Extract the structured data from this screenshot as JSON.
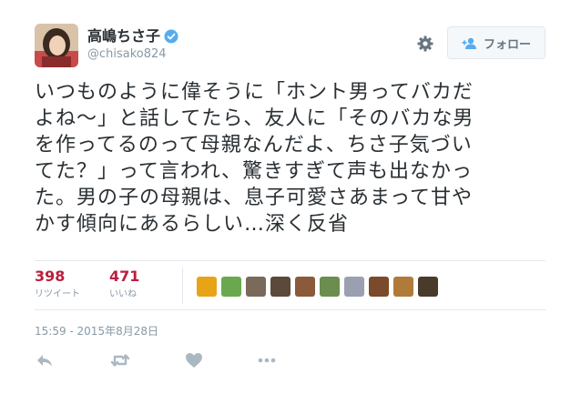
{
  "user": {
    "display_name": "高嶋ちさ子",
    "handle": "@chisako824",
    "verified": true
  },
  "follow_button": {
    "label": "フォロー"
  },
  "tweet": {
    "lines": [
      "いつものように偉そうに「ホント男ってバカだ",
      "よね〜」と話してたら、友人に「そのバカな男",
      "を作ってるのって母親なんだよ、ちさ子気づい",
      "てた？」って言われ、驚きすぎて声も出なかっ",
      "た。男の子の母親は、息子可愛さあまって甘や",
      "かす傾向にあるらしい…深く反省"
    ]
  },
  "stats": {
    "retweets": {
      "count": "398",
      "label": "リツイート"
    },
    "likes": {
      "count": "471",
      "label": "いいね"
    }
  },
  "liker_avatars": [
    {
      "name": "liker-avatar-1",
      "color": "#e8a317"
    },
    {
      "name": "liker-avatar-2",
      "color": "#6aa84f"
    },
    {
      "name": "liker-avatar-3",
      "color": "#7a6a5a"
    },
    {
      "name": "liker-avatar-4",
      "color": "#5b4a3a"
    },
    {
      "name": "liker-avatar-5",
      "color": "#8a5a3a"
    },
    {
      "name": "liker-avatar-6",
      "color": "#6b8e4e"
    },
    {
      "name": "liker-avatar-7",
      "color": "#9aa0b0"
    },
    {
      "name": "liker-avatar-8",
      "color": "#7a4a2a"
    },
    {
      "name": "liker-avatar-9",
      "color": "#b07a3a"
    },
    {
      "name": "liker-avatar-10",
      "color": "#4a3a2a"
    }
  ],
  "timestamp": "15:59 - 2015年8月28日",
  "colors": {
    "accent": "#bb1f3e",
    "verified_blue": "#55acee",
    "muted": "#8899a6",
    "border": "#e1e8ed"
  },
  "icons": {
    "settings": "gear-icon",
    "follow": "follow-user-icon",
    "reply": "reply-icon",
    "retweet": "retweet-icon",
    "like": "heart-icon",
    "more": "more-icon"
  }
}
